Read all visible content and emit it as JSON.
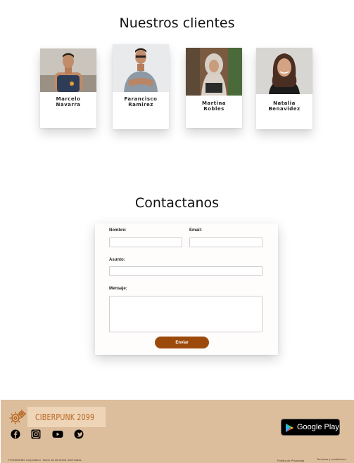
{
  "clients_section": {
    "title": "Nuestros clientes",
    "clients": [
      {
        "name": "Marcelo Navarra"
      },
      {
        "name": "Farancisco\nRamirez"
      },
      {
        "name": "Martina\nRobles"
      },
      {
        "name": "Natalia\nBenavidez"
      }
    ]
  },
  "contact_section": {
    "title": "Contactanos",
    "fields": {
      "name_label": "Nombre:",
      "email_label": "Email:",
      "subject_label": "Asunto:",
      "message_label": "Mensaje:"
    },
    "submit_label": "Enviar",
    "submit_color": "#9c4a0c"
  },
  "footer": {
    "brand": "CIBERPUNK 2099",
    "brand_color": "#b5651d",
    "background": "#dcbd9c",
    "social_icons": [
      "facebook-icon",
      "instagram-icon",
      "youtube-icon",
      "twitter-icon"
    ],
    "store_badge": "Google Play",
    "copyright": "POSSIDEMS Corporation. Todos los derechos reservados.",
    "links": [
      "Politica de Privacidad",
      "Terminos y condiciones"
    ]
  }
}
